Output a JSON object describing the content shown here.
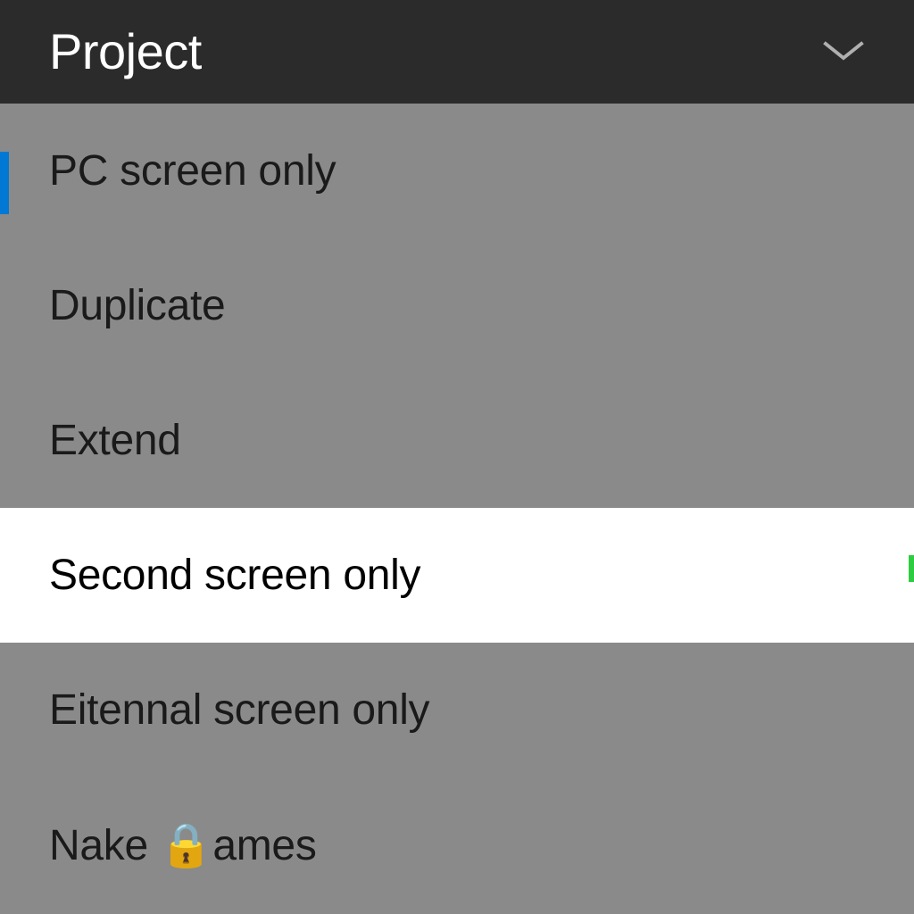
{
  "header": {
    "title": "Project"
  },
  "options": [
    {
      "label": "PC screen only",
      "selected": false
    },
    {
      "label": "Duplicate",
      "selected": false
    },
    {
      "label": "Extend",
      "selected": false
    },
    {
      "label": "Second screen only",
      "selected": true
    },
    {
      "label": "Eitennal screen only",
      "selected": false
    },
    {
      "label": "Nake 🔒ames",
      "selected": false
    }
  ]
}
